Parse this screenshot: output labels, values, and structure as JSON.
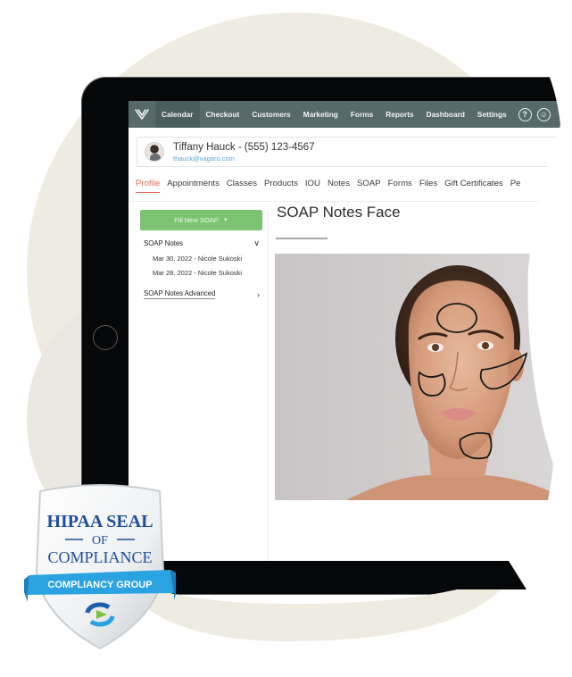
{
  "navbar": {
    "logo_icon": "vagaro-v-logo",
    "items": [
      {
        "label": "Calendar",
        "active": true
      },
      {
        "label": "Checkout",
        "active": false
      },
      {
        "label": "Customers",
        "active": false
      },
      {
        "label": "Marketing",
        "active": false
      },
      {
        "label": "Forms",
        "active": false
      },
      {
        "label": "Reports",
        "active": false
      },
      {
        "label": "Dashboard",
        "active": false
      },
      {
        "label": "Settings",
        "active": false
      }
    ],
    "help_icon_glyph": "?",
    "profile_icon_glyph": "☺"
  },
  "client": {
    "name_line": "Tiffany Hauck - (555) 123-4567",
    "email": "thauck@vagaro.com"
  },
  "tabs": [
    {
      "label": "Profile",
      "active": true
    },
    {
      "label": "Appointments",
      "active": false
    },
    {
      "label": "Classes",
      "active": false
    },
    {
      "label": "Products",
      "active": false
    },
    {
      "label": "IOU",
      "active": false
    },
    {
      "label": "Notes",
      "active": false
    },
    {
      "label": "SOAP",
      "active": false
    },
    {
      "label": "Forms",
      "active": false
    },
    {
      "label": "Files",
      "active": false
    },
    {
      "label": "Gift Certificates",
      "active": false
    },
    {
      "label": "Pe",
      "active": false
    }
  ],
  "sidebar": {
    "fill_button": "Fill New SOAP",
    "fill_caret": "▼",
    "soap_notes_label": "SOAP Notes",
    "soap_notes_chevron": "∨",
    "entries": [
      "Mar 30, 2022 - Nicole Sukoski",
      "Mar 28, 2022 - Nicole Sukoski"
    ],
    "advanced_label": "SOAP Notes Advanced",
    "advanced_chevron": "›"
  },
  "main": {
    "title": "SOAP Notes Face",
    "image_alt": "Face diagram with treatment zones outlined"
  },
  "seal": {
    "line1": "HIPAA SEAL",
    "line2": "OF",
    "line3": "COMPLIANCE",
    "ribbon": "COMPLIANCY GROUP"
  },
  "colors": {
    "navbar": "#56696b",
    "accent_tab": "#e06a5a",
    "fill_button": "#7cc472",
    "email_link": "#5aa8d8",
    "seal_blue": "#1d4f9a",
    "ribbon_blue": "#2aa3e0",
    "background_blob": "#eeebe1"
  }
}
